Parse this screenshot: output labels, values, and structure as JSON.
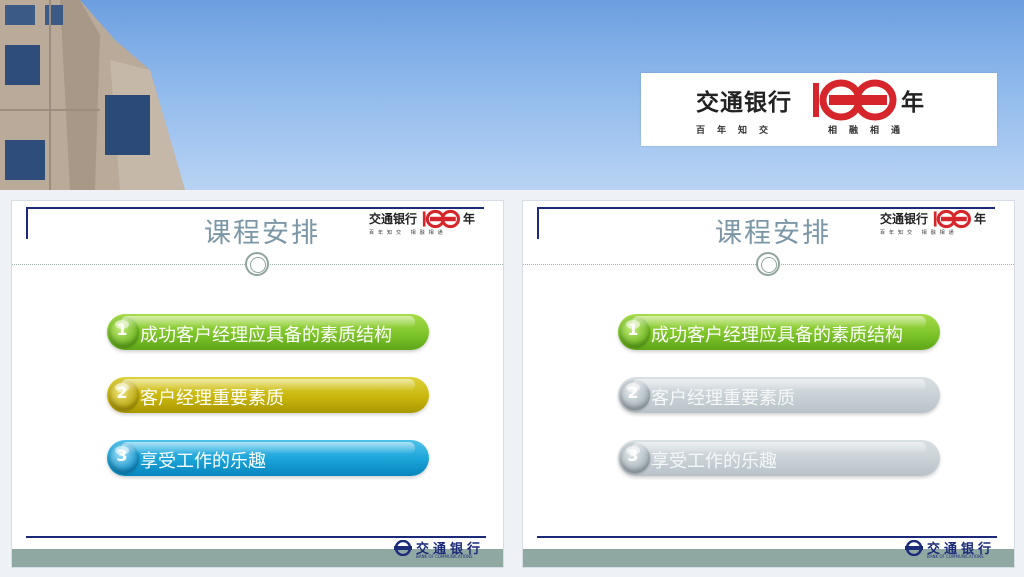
{
  "banner": {
    "bank_name": "交通银行",
    "year_char": "年",
    "slogan_left": "百年知交",
    "slogan_right": "相融相通",
    "badge_color": "#d6262b"
  },
  "slides": [
    {
      "title": "课程安排",
      "logo": {
        "bank_name": "交通银行",
        "year_char": "年",
        "slogan": "百年知交 相融相通"
      },
      "items": [
        {
          "num": "1",
          "label": "成功客户经理应具备的素质结构",
          "style": "green"
        },
        {
          "num": "2",
          "label": "客户经理重要素质",
          "style": "olive"
        },
        {
          "num": "3",
          "label": "享受工作的乐趣",
          "style": "blue"
        }
      ],
      "footer": {
        "name": "交通银行",
        "english": "BANK OF COMMUNICATIONS"
      }
    },
    {
      "title": "课程安排",
      "logo": {
        "bank_name": "交通银行",
        "year_char": "年",
        "slogan": "百年知交 相融相通"
      },
      "items": [
        {
          "num": "1",
          "label": "成功客户经理应具备的素质结构",
          "style": "green"
        },
        {
          "num": "2",
          "label": "客户经理重要素质",
          "style": "gray"
        },
        {
          "num": "3",
          "label": "享受工作的乐趣",
          "style": "gray"
        }
      ],
      "footer": {
        "name": "交通银行",
        "english": "BANK OF COMMUNICATIONS"
      }
    }
  ],
  "colors": {
    "accent_navy": "#1c2a7a",
    "green": "#7ec52a",
    "olive": "#c9b70f",
    "blue": "#1aa3d8",
    "inactive_gray": "#c8d1d6"
  }
}
